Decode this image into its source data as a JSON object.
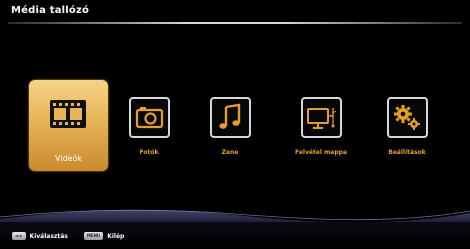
{
  "header": {
    "title": "Média tallózó"
  },
  "tiles": [
    {
      "label": "Videók",
      "icon": "film-icon",
      "selected": true
    },
    {
      "label": "Fotók",
      "icon": "camera-icon",
      "selected": false
    },
    {
      "label": "Zene",
      "icon": "music-note-icon",
      "selected": false
    },
    {
      "label": "Felvétel mappa",
      "icon": "monitor-usb-icon",
      "selected": false
    },
    {
      "label": "Beállítások",
      "icon": "gears-icon",
      "selected": false
    }
  ],
  "footer": {
    "navigate_key": "◄ ►",
    "navigate_label": "Kiválasztás",
    "menu_key": "MENU",
    "menu_label": "Kilép"
  },
  "colors": {
    "accent": "#e2a02b",
    "selected_tile": "#e7b457",
    "background": "#000000",
    "text": "#ffffff"
  }
}
